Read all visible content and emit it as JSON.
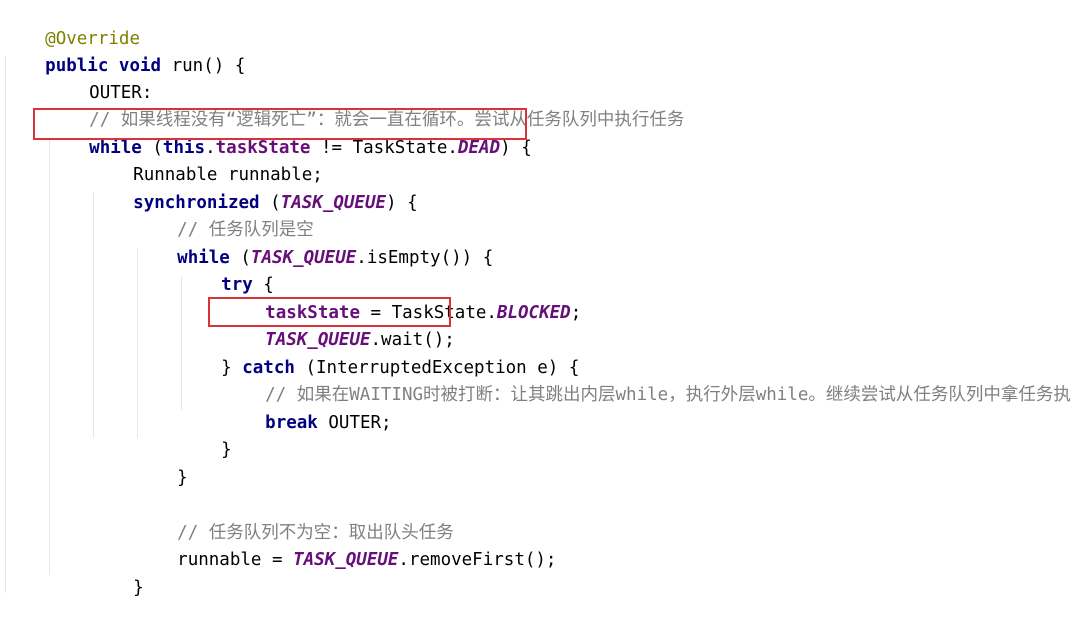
{
  "code": {
    "l1_annotation": "@Override",
    "l2_public": "public",
    "l2_void": "void",
    "l2_rest": " run() {",
    "l3_label": "OUTER",
    "l3_colon": ":",
    "l4_comment": "// 如果线程没有“逻辑死亡”：就会一直在循环。尝试从任务队列中执行任务",
    "l5_while": "while",
    "l5_open": " (",
    "l5_this": "this",
    "l5_dot": ".",
    "l5_field": "taskState",
    "l5_mid": " != TaskState.",
    "l5_const": "DEAD",
    "l5_close": ") {",
    "l6_text": "Runnable runnable;",
    "l7_sync": "synchronized",
    "l7_open": " (",
    "l7_const": "TASK_QUEUE",
    "l7_close": ") {",
    "l8_comment": "// 任务队列是空",
    "l9_while": "while",
    "l9_open": " (",
    "l9_const": "TASK_QUEUE",
    "l9_close": ".isEmpty()) {",
    "l10_try": "try",
    "l10_brace": " {",
    "l11_field": "taskState",
    "l11_mid": " = TaskState.",
    "l11_const": "BLOCKED",
    "l11_end": ";",
    "l12_const": "TASK_QUEUE",
    "l12_rest": ".wait();",
    "l13_pre": "} ",
    "l13_catch": "catch",
    "l13_rest": " (InterruptedException e) {",
    "l14_comment": "// 如果在WAITING时被打断：让其跳出内层while，执行外层while。继续尝试从任务队列中拿任务执行",
    "l15_break": "break",
    "l15_rest": " OUTER;",
    "l16_brace": "}",
    "l17_brace": "}",
    "l19_comment": "// 任务队列不为空：取出队头任务",
    "l20_pre": "runnable = ",
    "l20_const": "TASK_QUEUE",
    "l20_rest": ".removeFirst();",
    "l21_brace": "}"
  },
  "colors": {
    "keyword": "#000080",
    "field": "#660e7a",
    "comment": "#808080",
    "annotation": "#808000",
    "highlight": "#d9323a"
  }
}
